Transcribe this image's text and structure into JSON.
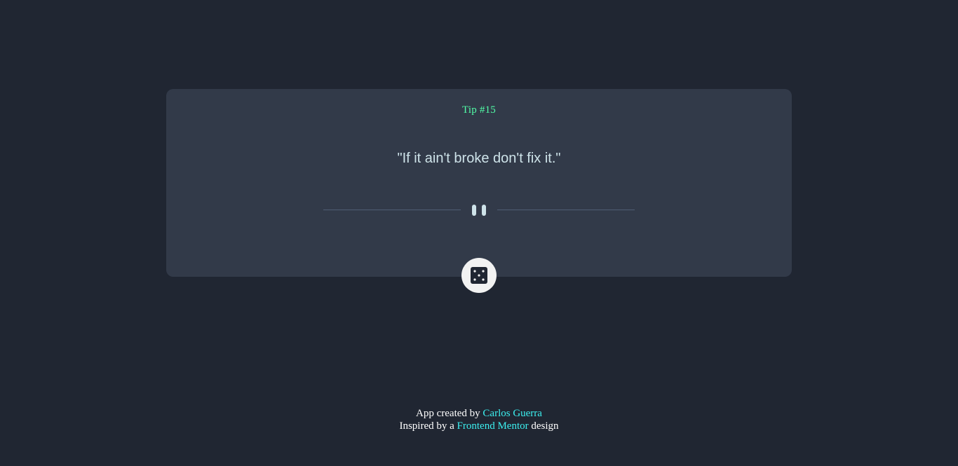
{
  "card": {
    "tip_label": "Tip #15",
    "quote": "\"If it ain't broke don't fix it.\"",
    "divider_icon": "pause-icon",
    "action_icon": "dice-icon"
  },
  "footer": {
    "line1_prefix": "App created by",
    "author_link": "Carlos Guerra",
    "line2_prefix": "Inspired by a",
    "mentor_link": "Frontend Mentor",
    "line2_suffix": "design"
  },
  "colors": {
    "background": "#202632",
    "card": "#323a49",
    "accent_green": "#52ffa8",
    "link_cyan": "#3cf0f0",
    "quote_text": "#cee3e9"
  }
}
